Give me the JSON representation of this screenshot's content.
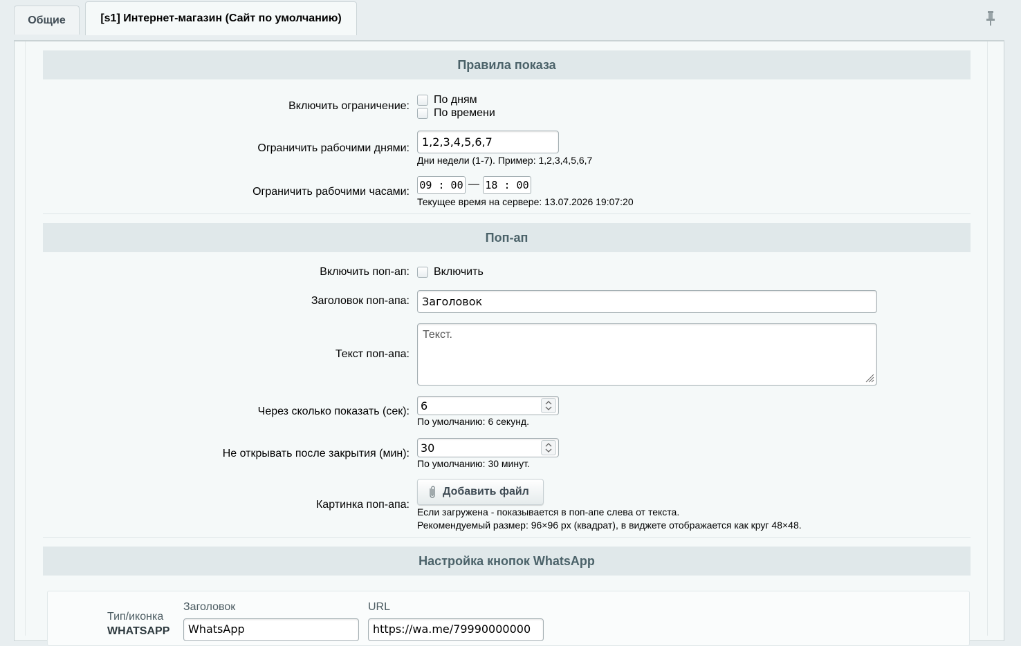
{
  "tabs": [
    {
      "label": "Общие"
    },
    {
      "label": "[s1] Интернет-магазин (Сайт по умолчанию)"
    }
  ],
  "sections": {
    "display_rules": {
      "title": "Правила показа"
    },
    "popup": {
      "title": "Поп-ап"
    },
    "whatsapp": {
      "title": "Настройка кнопок WhatsApp"
    }
  },
  "display_rules": {
    "limit_label": "Включить ограничение:",
    "by_days": "По дням",
    "by_time": "По времени",
    "work_days_label": "Ограничить рабочими днями:",
    "work_days_value": "1,2,3,4,5,6,7",
    "work_days_hint": "Дни недели (1-7). Пример: 1,2,3,4,5,6,7",
    "work_hours_label": "Ограничить рабочими часами:",
    "time_from": "09 : 00",
    "time_dash": "—",
    "time_to": "18 : 00",
    "server_time_hint": "Текущее время на сервере: 13.07.2026 19:07:20"
  },
  "popup": {
    "enable_label": "Включить поп-ап:",
    "enable_checkbox": "Включить",
    "title_label": "Заголовок поп-апа:",
    "title_value": "Заголовок",
    "text_label": "Текст поп-апа:",
    "text_value": "Текст.",
    "delay_label": "Через сколько показать (сек):",
    "delay_value": "6",
    "delay_hint": "По умолчанию: 6 секунд.",
    "reopen_label": "Не открывать после закрытия (мин):",
    "reopen_value": "30",
    "reopen_hint": "По умолчанию: 30 минут.",
    "image_label": "Картинка поп-апа:",
    "add_file_button": "Добавить файл",
    "image_hint1": "Если загружена - показывается в поп-апе слева от текста.",
    "image_hint2": "Рекомендуемый размер: 96×96 px (квадрат), в виджете отображается как круг 48×48."
  },
  "whatsapp": {
    "col_type": "Тип/иконка",
    "col_type_value": "WHATSAPP",
    "col_title": "Заголовок",
    "col_url": "URL",
    "title_value": "WhatsApp",
    "url_value": "https://wa.me/79990000000"
  }
}
